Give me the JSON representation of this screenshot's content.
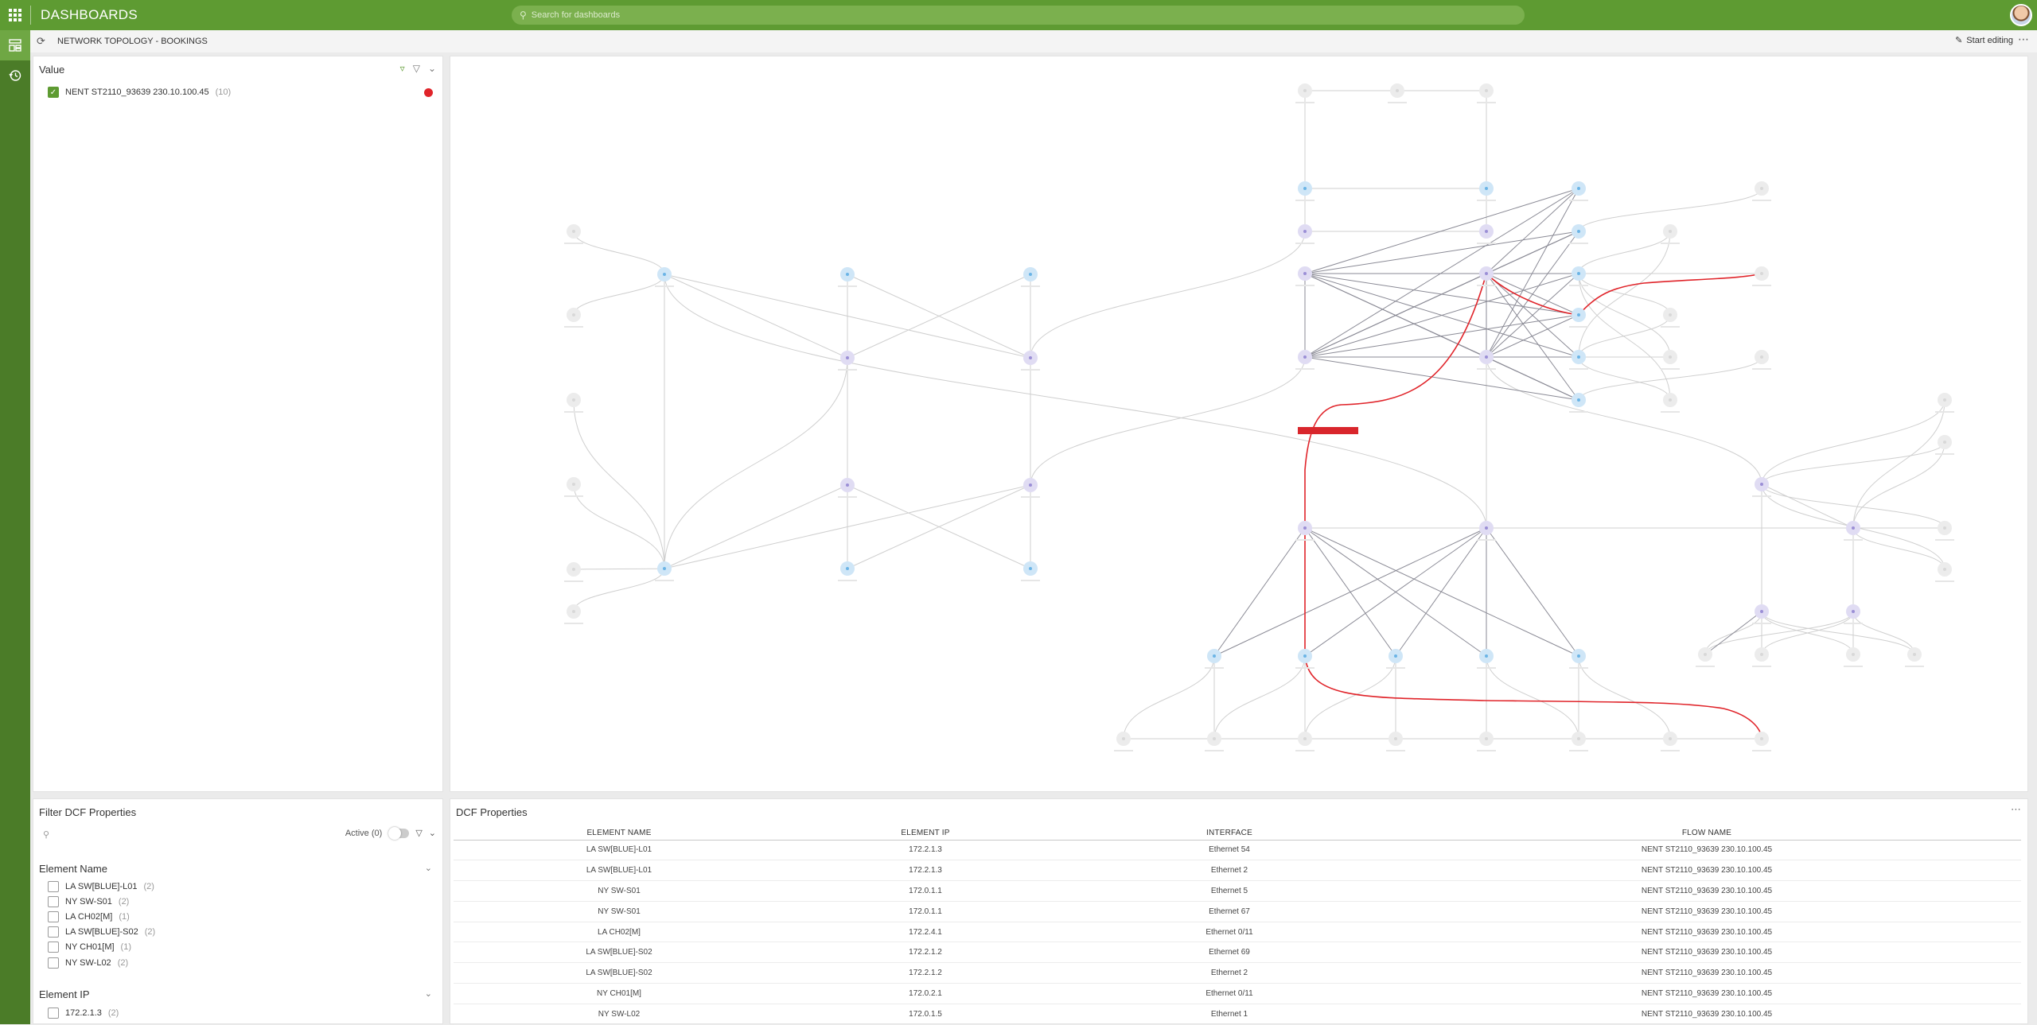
{
  "app": {
    "title": "DASHBOARDS",
    "search_placeholder": "Search for dashboards",
    "page_title": "NETWORK TOPOLOGY - BOOKINGS",
    "start_editing": "Start editing"
  },
  "colors": {
    "brand": "#5e9b32",
    "rail": "#4b7c28",
    "highlight_path": "#e0242a"
  },
  "value_panel": {
    "title": "Value",
    "items": [
      {
        "label": "NENT ST2110_93639 230.10.100.45",
        "count": "(10)",
        "checked": true
      }
    ]
  },
  "filter_panel": {
    "title": "Filter DCF Properties",
    "active_label": "Active (0)",
    "element_name": {
      "title": "Element Name",
      "items": [
        {
          "label": "LA SW[BLUE]-L01",
          "count": "(2)"
        },
        {
          "label": "NY SW-S01",
          "count": "(2)"
        },
        {
          "label": "LA CH02[M]",
          "count": "(1)"
        },
        {
          "label": "LA SW[BLUE]-S02",
          "count": "(2)"
        },
        {
          "label": "NY CH01[M]",
          "count": "(1)"
        },
        {
          "label": "NY SW-L02",
          "count": "(2)"
        }
      ]
    },
    "element_ip": {
      "title": "Element IP",
      "items": [
        {
          "label": "172.2.1.3",
          "count": "(2)"
        }
      ]
    }
  },
  "dcf_panel": {
    "title": "DCF Properties",
    "columns": [
      "ELEMENT NAME",
      "ELEMENT IP",
      "INTERFACE",
      "FLOW NAME"
    ],
    "rows": [
      [
        "LA SW[BLUE]-L01",
        "172.2.1.3",
        "Ethernet 54",
        "NENT ST2110_93639 230.10.100.45"
      ],
      [
        "LA SW[BLUE]-L01",
        "172.2.1.3",
        "Ethernet 2",
        "NENT ST2110_93639 230.10.100.45"
      ],
      [
        "NY SW-S01",
        "172.0.1.1",
        "Ethernet 5",
        "NENT ST2110_93639 230.10.100.45"
      ],
      [
        "NY SW-S01",
        "172.0.1.1",
        "Ethernet 67",
        "NENT ST2110_93639 230.10.100.45"
      ],
      [
        "LA CH02[M]",
        "172.2.4.1",
        "Ethernet 0/11",
        "NENT ST2110_93639 230.10.100.45"
      ],
      [
        "LA SW[BLUE]-S02",
        "172.2.1.2",
        "Ethernet 69",
        "NENT ST2110_93639 230.10.100.45"
      ],
      [
        "LA SW[BLUE]-S02",
        "172.2.1.2",
        "Ethernet 2",
        "NENT ST2110_93639 230.10.100.45"
      ],
      [
        "NY CH01[M]",
        "172.0.2.1",
        "Ethernet 0/11",
        "NENT ST2110_93639 230.10.100.45"
      ],
      [
        "NY SW-L02",
        "172.0.1.5",
        "Ethernet 1",
        "NENT ST2110_93639 230.10.100.45"
      ]
    ]
  }
}
